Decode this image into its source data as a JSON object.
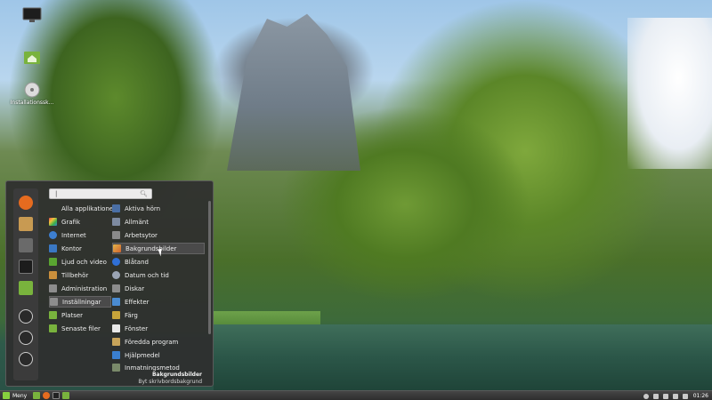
{
  "desktop": {
    "icons": [
      {
        "name": "monitor-icon",
        "label": ""
      },
      {
        "name": "home-folder-icon",
        "label": ""
      },
      {
        "name": "disc-icon",
        "label": "Installationssk..."
      }
    ]
  },
  "menu": {
    "search": {
      "placeholder": "",
      "value": "|"
    },
    "favorites": [
      {
        "name": "firefox-icon",
        "color": "#e66b1f"
      },
      {
        "name": "software-manager-icon",
        "color": "#c89a52"
      },
      {
        "name": "system-settings-icon",
        "color": "#6a6a6a"
      },
      {
        "name": "terminal-icon",
        "color": "#222222"
      },
      {
        "name": "files-icon",
        "color": "#79b33d"
      },
      {
        "name": "lock-icon",
        "color": "#444444"
      },
      {
        "name": "logout-icon",
        "color": "#444444"
      },
      {
        "name": "power-icon",
        "color": "#444444"
      }
    ],
    "categories": [
      {
        "label": "Alla applikationer",
        "icon": "none",
        "color": "#2e2e2e"
      },
      {
        "label": "Grafik",
        "icon": "graphics-icon",
        "color": "#d94f8c"
      },
      {
        "label": "Internet",
        "icon": "internet-icon",
        "color": "#3d7fd1"
      },
      {
        "label": "Kontor",
        "icon": "office-icon",
        "color": "#3a78c3"
      },
      {
        "label": "Ljud och video",
        "icon": "multimedia-icon",
        "color": "#5aa531"
      },
      {
        "label": "Tillbehör",
        "icon": "accessories-icon",
        "color": "#c98f3c"
      },
      {
        "label": "Administration",
        "icon": "administration-icon",
        "color": "#8d8d8d"
      },
      {
        "label": "Inställningar",
        "icon": "settings-icon",
        "color": "#8d8d8d"
      },
      {
        "label": "Platser",
        "icon": "places-icon",
        "color": "#79b33d"
      },
      {
        "label": "Senaste filer",
        "icon": "recent-files-icon",
        "color": "#79b33d"
      }
    ],
    "apps": [
      {
        "label": "Aktiva hörn",
        "icon": "hot-corners-icon",
        "color": "#4a6fa5"
      },
      {
        "label": "Allmänt",
        "icon": "general-icon",
        "color": "#7d8aa0"
      },
      {
        "label": "Arbetsytor",
        "icon": "workspaces-icon",
        "color": "#8a8a8a"
      },
      {
        "label": "Bakgrundsbilder",
        "icon": "backgrounds-icon",
        "color": "#d08a2e"
      },
      {
        "label": "Blåtand",
        "icon": "bluetooth-icon",
        "color": "#2f6fd6"
      },
      {
        "label": "Datum och tid",
        "icon": "date-time-icon",
        "color": "#9aa4b4"
      },
      {
        "label": "Diskar",
        "icon": "disks-icon",
        "color": "#8c8c8c"
      },
      {
        "label": "Effekter",
        "icon": "effects-icon",
        "color": "#4a8bd1"
      },
      {
        "label": "Färg",
        "icon": "color-icon",
        "color": "#c7a43a"
      },
      {
        "label": "Fönster",
        "icon": "windows-icon",
        "color": "#e8e8e8"
      },
      {
        "label": "Föredda program",
        "icon": "preferred-apps-icon",
        "color": "#c8a45a"
      },
      {
        "label": "Hjälpmedel",
        "icon": "accessibility-icon",
        "color": "#3a7fd0"
      },
      {
        "label": "Inmatningsmetod",
        "icon": "input-method-icon",
        "color": "#7a8a6a"
      }
    ],
    "description": {
      "title": "Bakgrundsbilder",
      "subtitle": "Byt skrivbordsbakgrund"
    }
  },
  "taskbar": {
    "menu_label": "Meny",
    "launchers": [
      {
        "name": "show-desktop-icon",
        "color": "#79b33d"
      },
      {
        "name": "firefox-launcher-icon",
        "color": "#e66b1f"
      },
      {
        "name": "terminal-launcher-icon",
        "color": "#222222"
      },
      {
        "name": "files-launcher-icon",
        "color": "#79b33d"
      }
    ],
    "tray": [
      "user-icon",
      "bluetooth-tray-icon",
      "network-icon",
      "edit-icon",
      "volume-icon"
    ],
    "clock": "01:26"
  }
}
